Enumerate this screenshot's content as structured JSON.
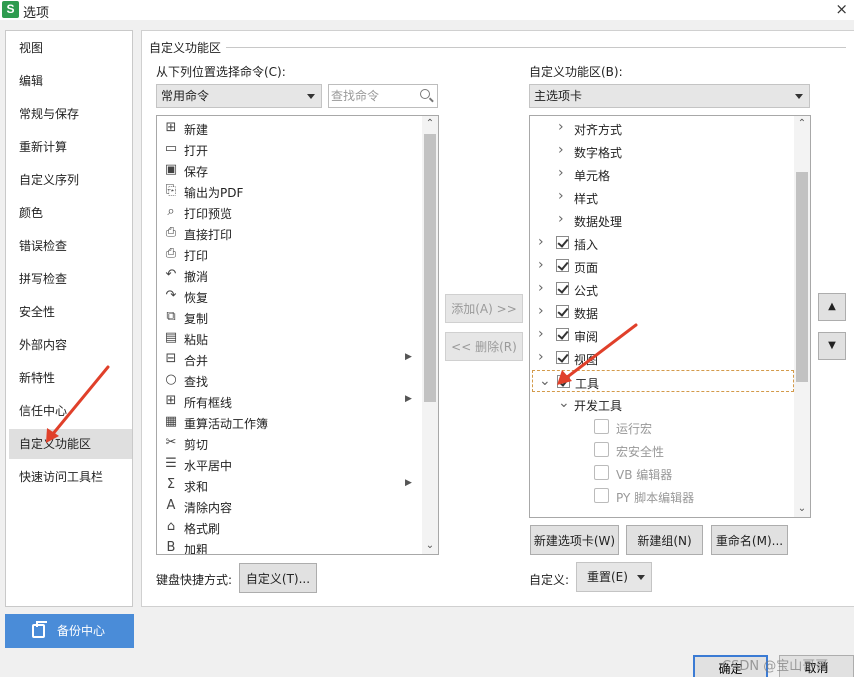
{
  "window": {
    "title": "选项",
    "app_icon": "S",
    "close": "×"
  },
  "sidebar": {
    "items": [
      {
        "label": "视图"
      },
      {
        "label": "编辑"
      },
      {
        "label": "常规与保存"
      },
      {
        "label": "重新计算"
      },
      {
        "label": "自定义序列"
      },
      {
        "label": "颜色"
      },
      {
        "label": "错误检查"
      },
      {
        "label": "拼写检查"
      },
      {
        "label": "安全性"
      },
      {
        "label": "外部内容"
      },
      {
        "label": "新特性"
      },
      {
        "label": "信任中心"
      },
      {
        "label": "自定义功能区"
      },
      {
        "label": "快速访问工具栏"
      }
    ],
    "active": "自定义功能区",
    "backup_label": "备份中心"
  },
  "main": {
    "section_title": "自定义功能区",
    "left": {
      "label": "从下列位置选择命令(C):",
      "dropdown_value": "常用命令",
      "search_placeholder": "查找命令",
      "commands": [
        {
          "label": "新建",
          "icon": "new-doc-icon",
          "glyph": "⊞"
        },
        {
          "label": "打开",
          "icon": "folder-open-icon",
          "glyph": "▭"
        },
        {
          "label": "保存",
          "icon": "save-icon",
          "glyph": "▣"
        },
        {
          "label": "输出为PDF",
          "icon": "pdf-export-icon",
          "glyph": "⎘"
        },
        {
          "label": "打印预览",
          "icon": "print-preview-icon",
          "glyph": "⌕"
        },
        {
          "label": "直接打印",
          "icon": "quick-print-icon",
          "glyph": "⎙"
        },
        {
          "label": "打印",
          "icon": "print-icon",
          "glyph": "⎙"
        },
        {
          "label": "撤消",
          "icon": "undo-icon",
          "glyph": "↶"
        },
        {
          "label": "恢复",
          "icon": "redo-icon",
          "glyph": "↷"
        },
        {
          "label": "复制",
          "icon": "copy-icon",
          "glyph": "⧉"
        },
        {
          "label": "粘贴",
          "icon": "paste-icon",
          "glyph": "▤"
        },
        {
          "label": "合并",
          "icon": "merge-cells-icon",
          "glyph": "⊟",
          "submenu": true
        },
        {
          "label": "查找",
          "icon": "find-icon",
          "glyph": "○"
        },
        {
          "label": "所有框线",
          "icon": "borders-icon",
          "glyph": "⊞",
          "submenu": true
        },
        {
          "label": "重算活动工作簿",
          "icon": "recalc-icon",
          "glyph": "▦"
        },
        {
          "label": "剪切",
          "icon": "cut-icon",
          "glyph": "✂"
        },
        {
          "label": "水平居中",
          "icon": "center-align-icon",
          "glyph": "☰"
        },
        {
          "label": "求和",
          "icon": "sum-icon",
          "glyph": "Σ",
          "submenu": true
        },
        {
          "label": "清除内容",
          "icon": "clear-icon",
          "glyph": "A"
        },
        {
          "label": "格式刷",
          "icon": "format-painter-icon",
          "glyph": "⌂"
        },
        {
          "label": "加粗",
          "icon": "bold-icon",
          "glyph": "B"
        }
      ],
      "shortcut_label": "键盘快捷方式:",
      "shortcut_button": "自定义(T)..."
    },
    "middle": {
      "add_button": "添加(A) >>",
      "remove_button": "<< 删除(R)"
    },
    "right": {
      "label": "自定义功能区(B):",
      "dropdown_value": "主选项卡",
      "tree": [
        {
          "label": "对齐方式",
          "level": 1,
          "expand": "collapsed"
        },
        {
          "label": "数字格式",
          "level": 1,
          "expand": "collapsed"
        },
        {
          "label": "单元格",
          "level": 1,
          "expand": "collapsed"
        },
        {
          "label": "样式",
          "level": 1,
          "expand": "collapsed"
        },
        {
          "label": "数据处理",
          "level": 1,
          "expand": "collapsed"
        },
        {
          "label": "插入",
          "level": 0,
          "checked": true,
          "expand": "collapsed"
        },
        {
          "label": "页面",
          "level": 0,
          "checked": true,
          "expand": "collapsed"
        },
        {
          "label": "公式",
          "level": 0,
          "checked": true,
          "expand": "collapsed"
        },
        {
          "label": "数据",
          "level": 0,
          "checked": true,
          "expand": "collapsed"
        },
        {
          "label": "审阅",
          "level": 0,
          "checked": true,
          "expand": "collapsed"
        },
        {
          "label": "视图",
          "level": 0,
          "checked": true,
          "expand": "collapsed"
        },
        {
          "label": "工具",
          "level": 0,
          "checked": true,
          "expand": "expanded",
          "selected": true
        },
        {
          "label": "开发工具",
          "level": 1,
          "expand": "expanded"
        },
        {
          "label": "运行宏",
          "level": 2,
          "disabled": true
        },
        {
          "label": "宏安全性",
          "level": 2,
          "disabled": true
        },
        {
          "label": "VB 编辑器",
          "level": 2,
          "disabled": true
        },
        {
          "label": "PY 脚本编辑器",
          "level": 2,
          "disabled": true
        }
      ],
      "new_tab_button": "新建选项卡(W)",
      "new_group_button": "新建组(N)",
      "rename_button": "重命名(M)...",
      "customize_label": "自定义:",
      "reset_button": "重置(E)",
      "move_up": "▲",
      "move_down": "▼"
    }
  },
  "footer": {
    "ok_button": "确定",
    "cancel_button": "取消",
    "watermark": "CSDN @宝山哥哥"
  },
  "colors": {
    "accent": "#4a8cd8",
    "annotation_arrow": "#e0402a",
    "active_nav": "#dfdfdf"
  }
}
